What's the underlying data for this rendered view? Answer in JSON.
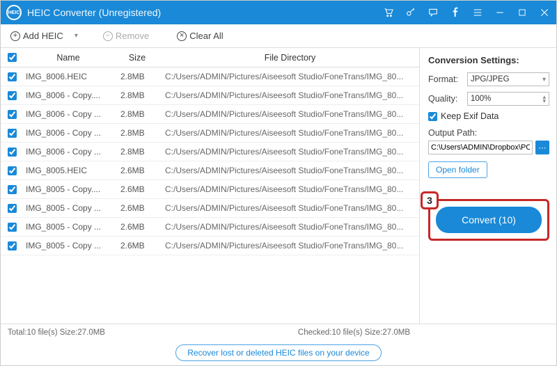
{
  "titlebar": {
    "app_name": "HEIC Converter (Unregistered)"
  },
  "toolbar": {
    "add_label": "Add HEIC",
    "remove_label": "Remove",
    "clearall_label": "Clear All"
  },
  "table": {
    "head_name": "Name",
    "head_size": "Size",
    "head_dir": "File Directory",
    "rows": [
      {
        "name": "IMG_8006.HEIC",
        "size": "2.8MB",
        "dir": "C:/Users/ADMIN/Pictures/Aiseesoft Studio/FoneTrans/IMG_80..."
      },
      {
        "name": "IMG_8006 - Copy....",
        "size": "2.8MB",
        "dir": "C:/Users/ADMIN/Pictures/Aiseesoft Studio/FoneTrans/IMG_80..."
      },
      {
        "name": "IMG_8006 - Copy ...",
        "size": "2.8MB",
        "dir": "C:/Users/ADMIN/Pictures/Aiseesoft Studio/FoneTrans/IMG_80..."
      },
      {
        "name": "IMG_8006 - Copy ...",
        "size": "2.8MB",
        "dir": "C:/Users/ADMIN/Pictures/Aiseesoft Studio/FoneTrans/IMG_80..."
      },
      {
        "name": "IMG_8006 - Copy ...",
        "size": "2.8MB",
        "dir": "C:/Users/ADMIN/Pictures/Aiseesoft Studio/FoneTrans/IMG_80..."
      },
      {
        "name": "IMG_8005.HEIC",
        "size": "2.6MB",
        "dir": "C:/Users/ADMIN/Pictures/Aiseesoft Studio/FoneTrans/IMG_80..."
      },
      {
        "name": "IMG_8005 - Copy....",
        "size": "2.6MB",
        "dir": "C:/Users/ADMIN/Pictures/Aiseesoft Studio/FoneTrans/IMG_80..."
      },
      {
        "name": "IMG_8005 - Copy ...",
        "size": "2.6MB",
        "dir": "C:/Users/ADMIN/Pictures/Aiseesoft Studio/FoneTrans/IMG_80..."
      },
      {
        "name": "IMG_8005 - Copy ...",
        "size": "2.6MB",
        "dir": "C:/Users/ADMIN/Pictures/Aiseesoft Studio/FoneTrans/IMG_80..."
      },
      {
        "name": "IMG_8005 - Copy ...",
        "size": "2.6MB",
        "dir": "C:/Users/ADMIN/Pictures/Aiseesoft Studio/FoneTrans/IMG_80..."
      }
    ]
  },
  "settings": {
    "title": "Conversion Settings:",
    "format_label": "Format:",
    "format_value": "JPG/JPEG",
    "quality_label": "Quality:",
    "quality_value": "100%",
    "keep_exif_label": "Keep Exif Data",
    "output_path_label": "Output Path:",
    "output_path_value": "C:\\Users\\ADMIN\\Dropbox\\PC\\",
    "open_folder_label": "Open folder",
    "step_badge": "3",
    "convert_label": "Convert (10)"
  },
  "status": {
    "total": "Total:10 file(s) Size:27.0MB",
    "checked": "Checked:10 file(s) Size:27.0MB"
  },
  "footer": {
    "recover_label": "Recover lost or deleted HEIC files on your device"
  }
}
